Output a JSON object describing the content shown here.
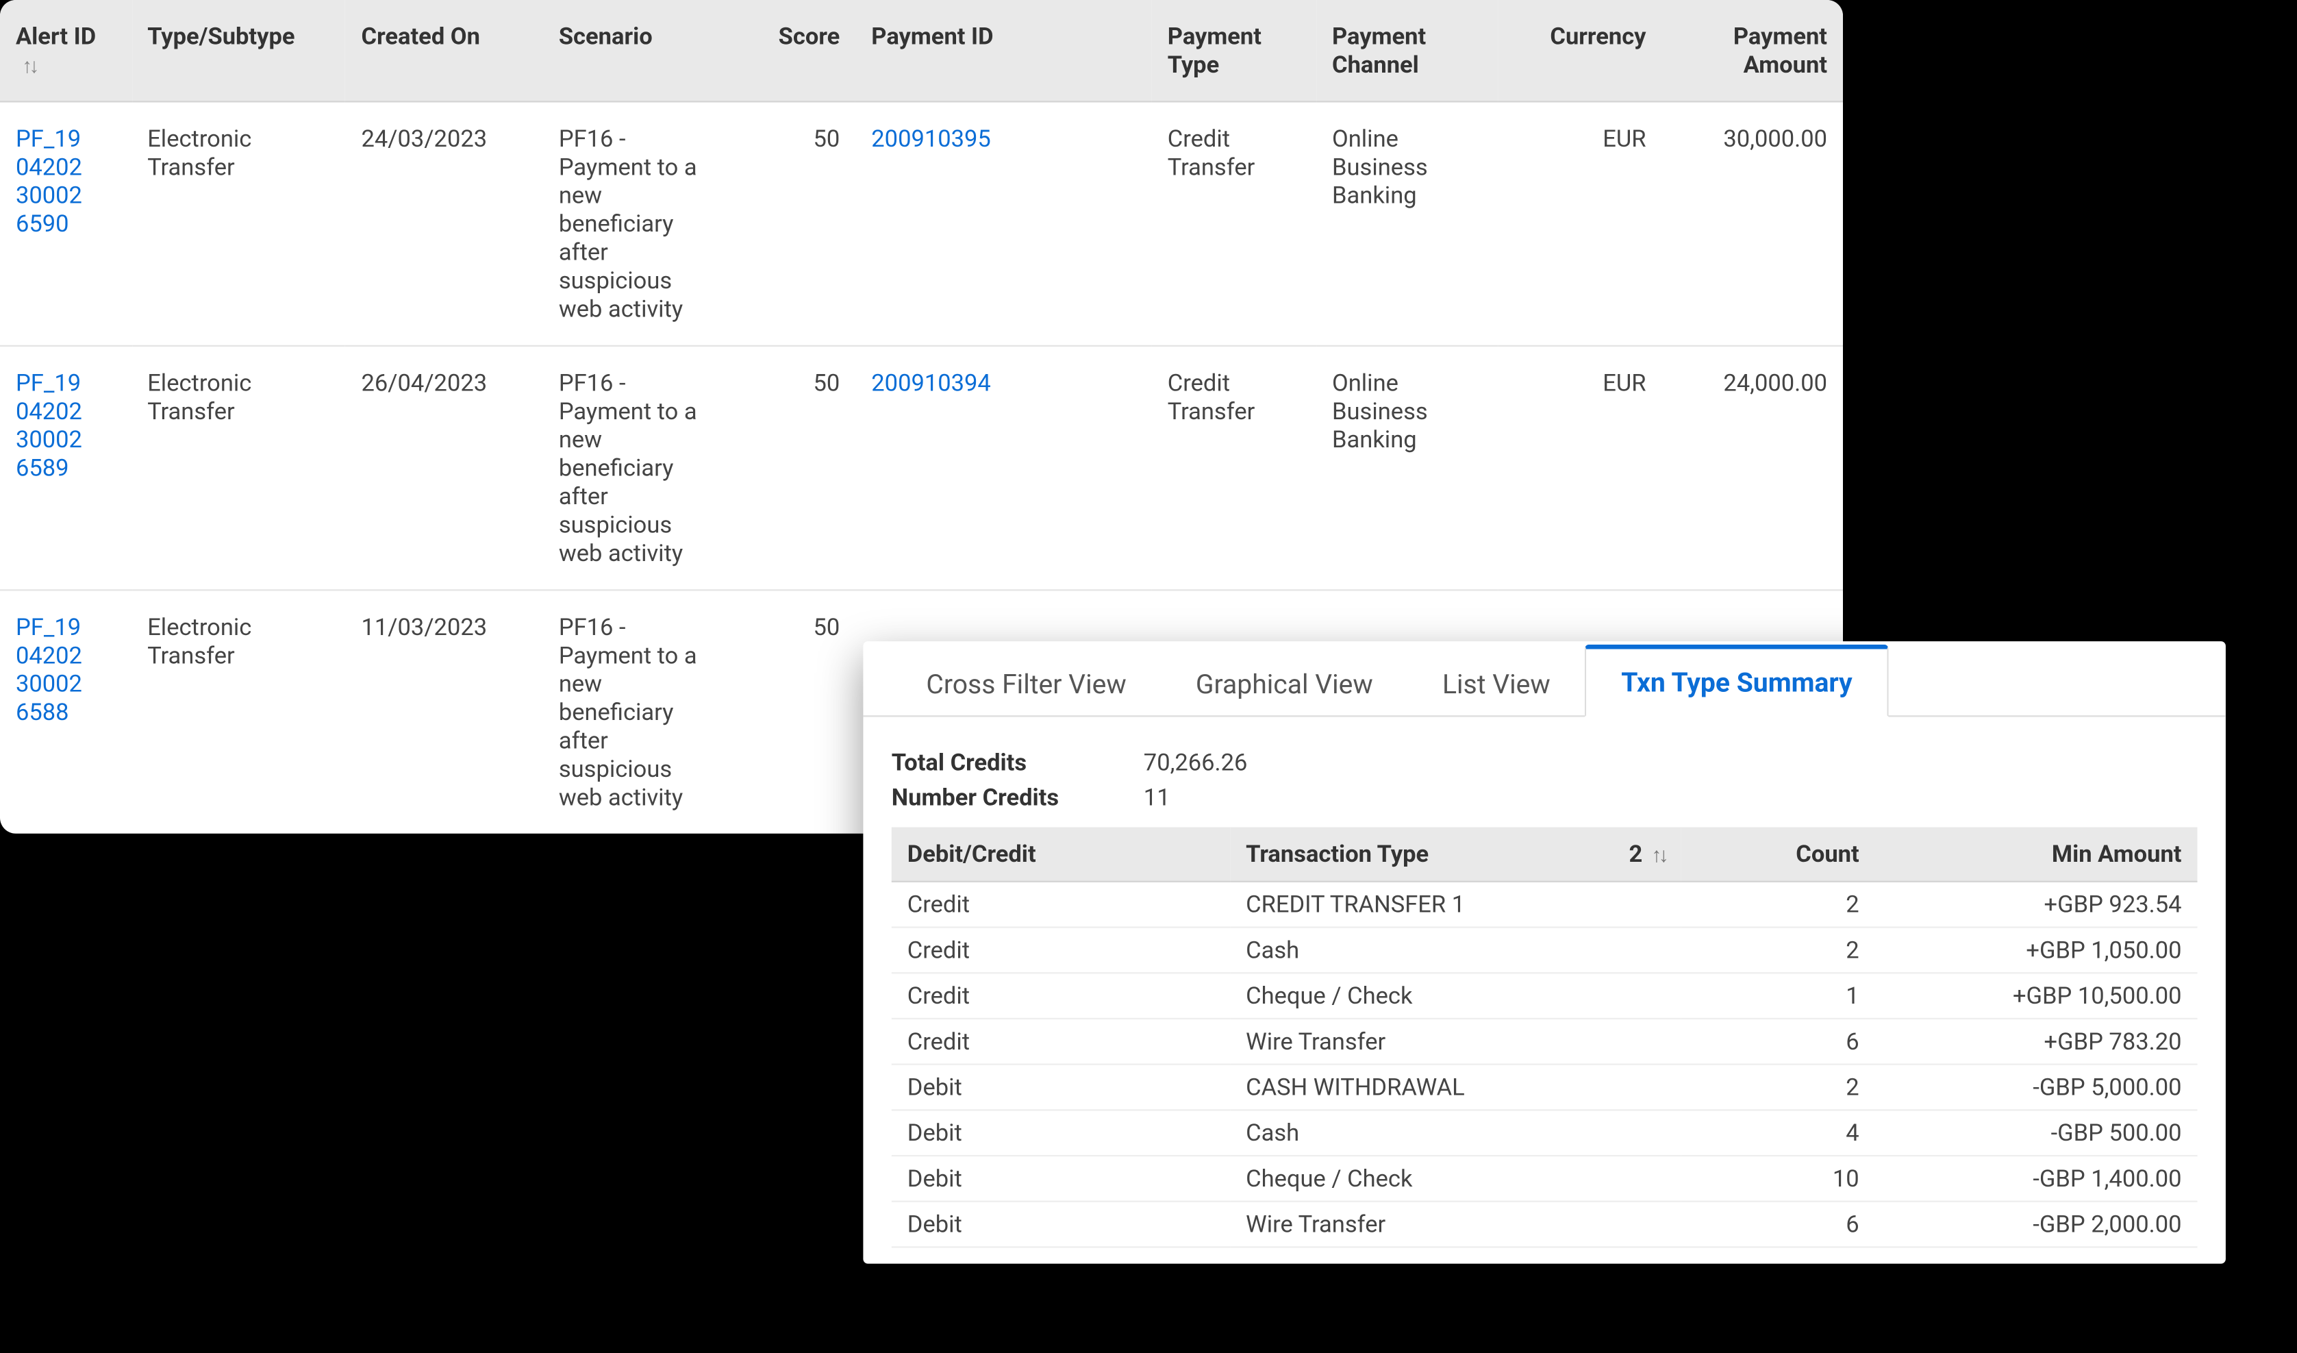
{
  "alerts_table": {
    "headers": {
      "alert_id": "Alert ID",
      "type": "Type/Subtype",
      "created": "Created On",
      "scenario": "Scenario",
      "score": "Score",
      "payment_id": "Payment ID",
      "payment_type": "Payment Type",
      "payment_channel": "Payment Channel",
      "currency": "Currency",
      "payment_amount": "Payment Amount"
    },
    "rows": [
      {
        "alert_id": "PF_19042023000_26590",
        "alert_id_display": "PF_19\n04202\n30002\n6590",
        "type": "Electronic Transfer",
        "created": "24/03/2023",
        "scenario": "PF16 - Payment to a new beneficiary after suspicious web activity",
        "score": "50",
        "payment_id": "200910395",
        "payment_type": "Credit Transfer",
        "payment_channel": "Online Business Banking",
        "currency": "EUR",
        "payment_amount": "30,000.00"
      },
      {
        "alert_id": "PF_19042023000_26589",
        "alert_id_display": "PF_19\n04202\n30002\n6589",
        "type": "Electronic Transfer",
        "created": "26/04/2023",
        "scenario": "PF16 - Payment to a new beneficiary after suspicious web activity",
        "score": "50",
        "payment_id": "200910394",
        "payment_type": "Credit Transfer",
        "payment_channel": "Online Business Banking",
        "currency": "EUR",
        "payment_amount": "24,000.00"
      },
      {
        "alert_id": "PF_19042023000_26588",
        "alert_id_display": "PF_19\n04202\n30002\n6588",
        "type": "Electronic Transfer",
        "created": "11/03/2023",
        "scenario": "PF16 - Payment to a new beneficiary after suspicious web activity",
        "score": "50",
        "payment_id": "",
        "payment_type": "",
        "payment_channel": "",
        "currency": "",
        "payment_amount": ""
      }
    ]
  },
  "front_panel": {
    "tabs": [
      {
        "label": "Cross Filter View",
        "active": false
      },
      {
        "label": "Graphical View",
        "active": false
      },
      {
        "label": "List View",
        "active": false
      },
      {
        "label": "Txn Type Summary",
        "active": true
      }
    ],
    "summary": {
      "total_credits_label": "Total Credits",
      "total_credits_value": "70,266.26",
      "number_credits_label": "Number Credits",
      "number_credits_value": "11"
    },
    "txn_table": {
      "headers": {
        "dc": "Debit/Credit",
        "type": "Transaction Type",
        "sort_num": "2",
        "count": "Count",
        "min": "Min Amount"
      },
      "rows": [
        {
          "dc": "Credit",
          "type": "CREDIT TRANSFER 1",
          "count": "2",
          "min": "+GBP 923.54",
          "neg": false
        },
        {
          "dc": "Credit",
          "type": "Cash",
          "count": "2",
          "min": "+GBP 1,050.00",
          "neg": false
        },
        {
          "dc": "Credit",
          "type": "Cheque / Check",
          "count": "1",
          "min": "+GBP 10,500.00",
          "neg": false
        },
        {
          "dc": "Credit",
          "type": "Wire Transfer",
          "count": "6",
          "min": "+GBP 783.20",
          "neg": false
        },
        {
          "dc": "Debit",
          "type": "CASH WITHDRAWAL",
          "count": "2",
          "min": "-GBP 5,000.00",
          "neg": true
        },
        {
          "dc": "Debit",
          "type": "Cash",
          "count": "4",
          "min": "-GBP 500.00",
          "neg": true
        },
        {
          "dc": "Debit",
          "type": "Cheque / Check",
          "count": "10",
          "min": "-GBP 1,400.00",
          "neg": true
        },
        {
          "dc": "Debit",
          "type": "Wire Transfer",
          "count": "6",
          "min": "-GBP 2,000.00",
          "neg": true
        }
      ]
    }
  }
}
